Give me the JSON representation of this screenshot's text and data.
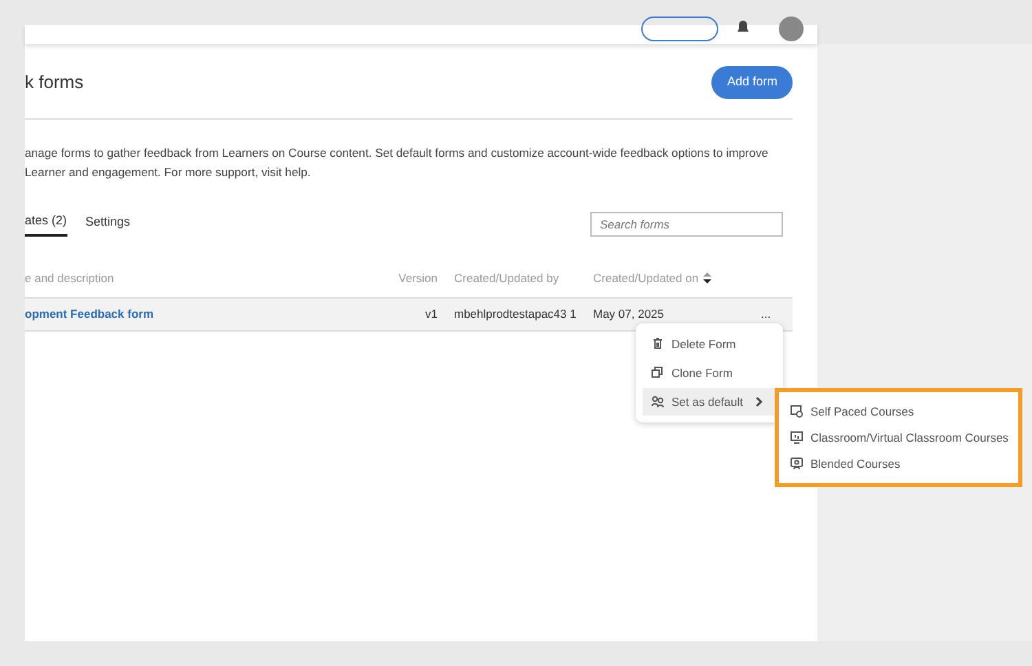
{
  "page": {
    "title": "k forms",
    "add_button": "Add form",
    "description": "anage forms to gather feedback from Learners on Course content. Set default forms and customize account-wide feedback options to improve Learner and engagement. For more support, visit help."
  },
  "tabs": [
    {
      "label": "ates (2)",
      "selected": true
    },
    {
      "label": "Settings",
      "selected": false
    }
  ],
  "search": {
    "placeholder": "Search forms"
  },
  "table": {
    "columns": [
      "e and description",
      "Version",
      "Created/Updated by",
      "Created/Updated on"
    ],
    "rows": [
      {
        "name": "opment Feedback form",
        "version": "v1",
        "by": "mbehlprodtestapac43 1",
        "on": "May 07, 2025",
        "actions": "..."
      }
    ]
  },
  "menu": [
    {
      "label": "Delete Form",
      "kind": "delete",
      "selected": false,
      "submenu": false
    },
    {
      "label": "Clone Form",
      "kind": "clone",
      "selected": false,
      "submenu": false
    },
    {
      "label": "Set as default",
      "kind": "default",
      "selected": true,
      "submenu": true
    }
  ],
  "submenu": [
    {
      "label": "Self Paced Courses",
      "kind": "selfpaced"
    },
    {
      "label": "Classroom/Virtual Classroom Courses",
      "kind": "classroom"
    },
    {
      "label": "Blended Courses",
      "kind": "blended"
    }
  ]
}
